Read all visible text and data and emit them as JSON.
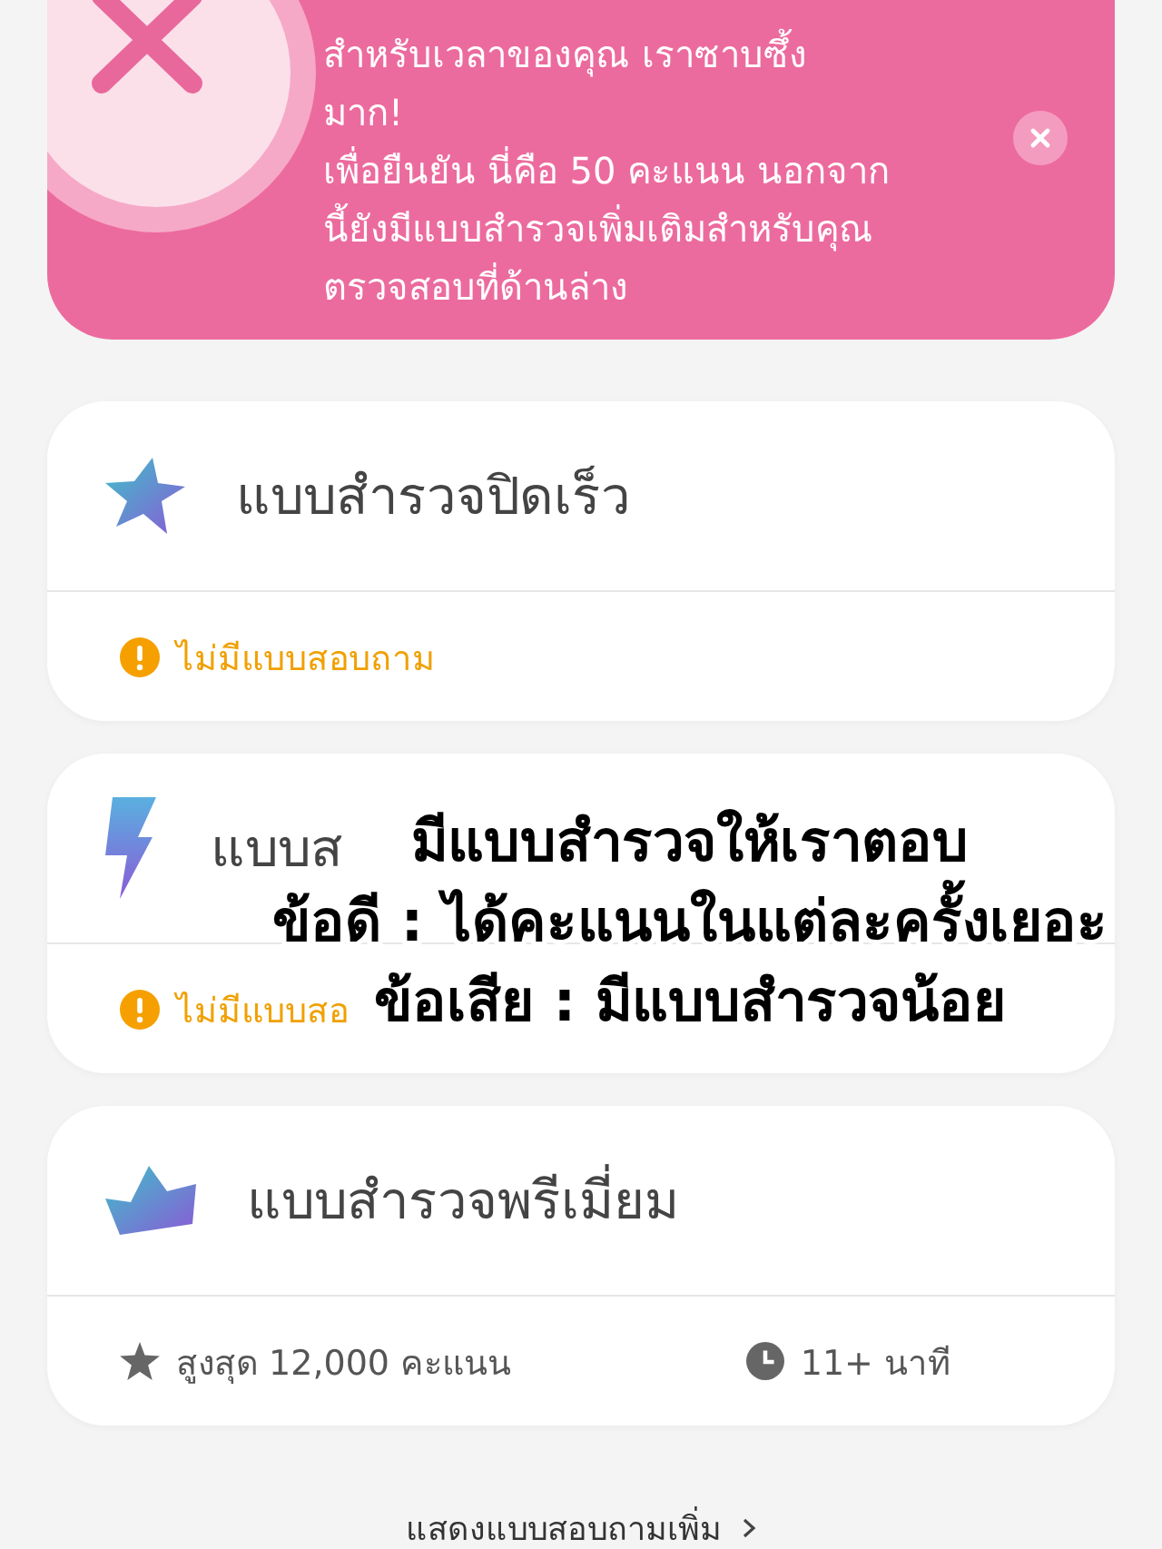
{
  "banner": {
    "paragraphs": [
      {
        "lines": [
          "สำหรับเวลาของคุณ เราซาบซึ้ง",
          "มาก!"
        ]
      },
      {
        "lines": [
          "เพื่อยืนยัน นี่คือ 50 คะแนน นอกจาก",
          "นี้ยังมีแบบสำรวจเพิ่มเติมสำหรับคุณ",
          "ตรวจสอบที่ด้านล่าง"
        ]
      }
    ]
  },
  "cards": [
    {
      "kind": "star",
      "title": "แบบสำรวจปิดเร็ว",
      "notice": "ไม่มีแบบสอบถาม"
    },
    {
      "kind": "bolt",
      "title": "แบบส",
      "notice": "ไม่มีแบบสอ"
    },
    {
      "kind": "crown",
      "title": "แบบสำรวจพรีเมี่ยม",
      "max_points": "สูงสุด 12,000 คะแนน",
      "duration": "11+ นาที"
    }
  ],
  "overlay_caption": [
    "มีแบบสำรวจให้เราตอบ",
    "ข้อดี : ได้คะแนนในแต่ละครั้งเยอะ",
    "ข้อเสีย : มีแบบสำรวจน้อย"
  ],
  "more_link": {
    "label": "แสดงแบบสอบถามเพิ่ม"
  }
}
